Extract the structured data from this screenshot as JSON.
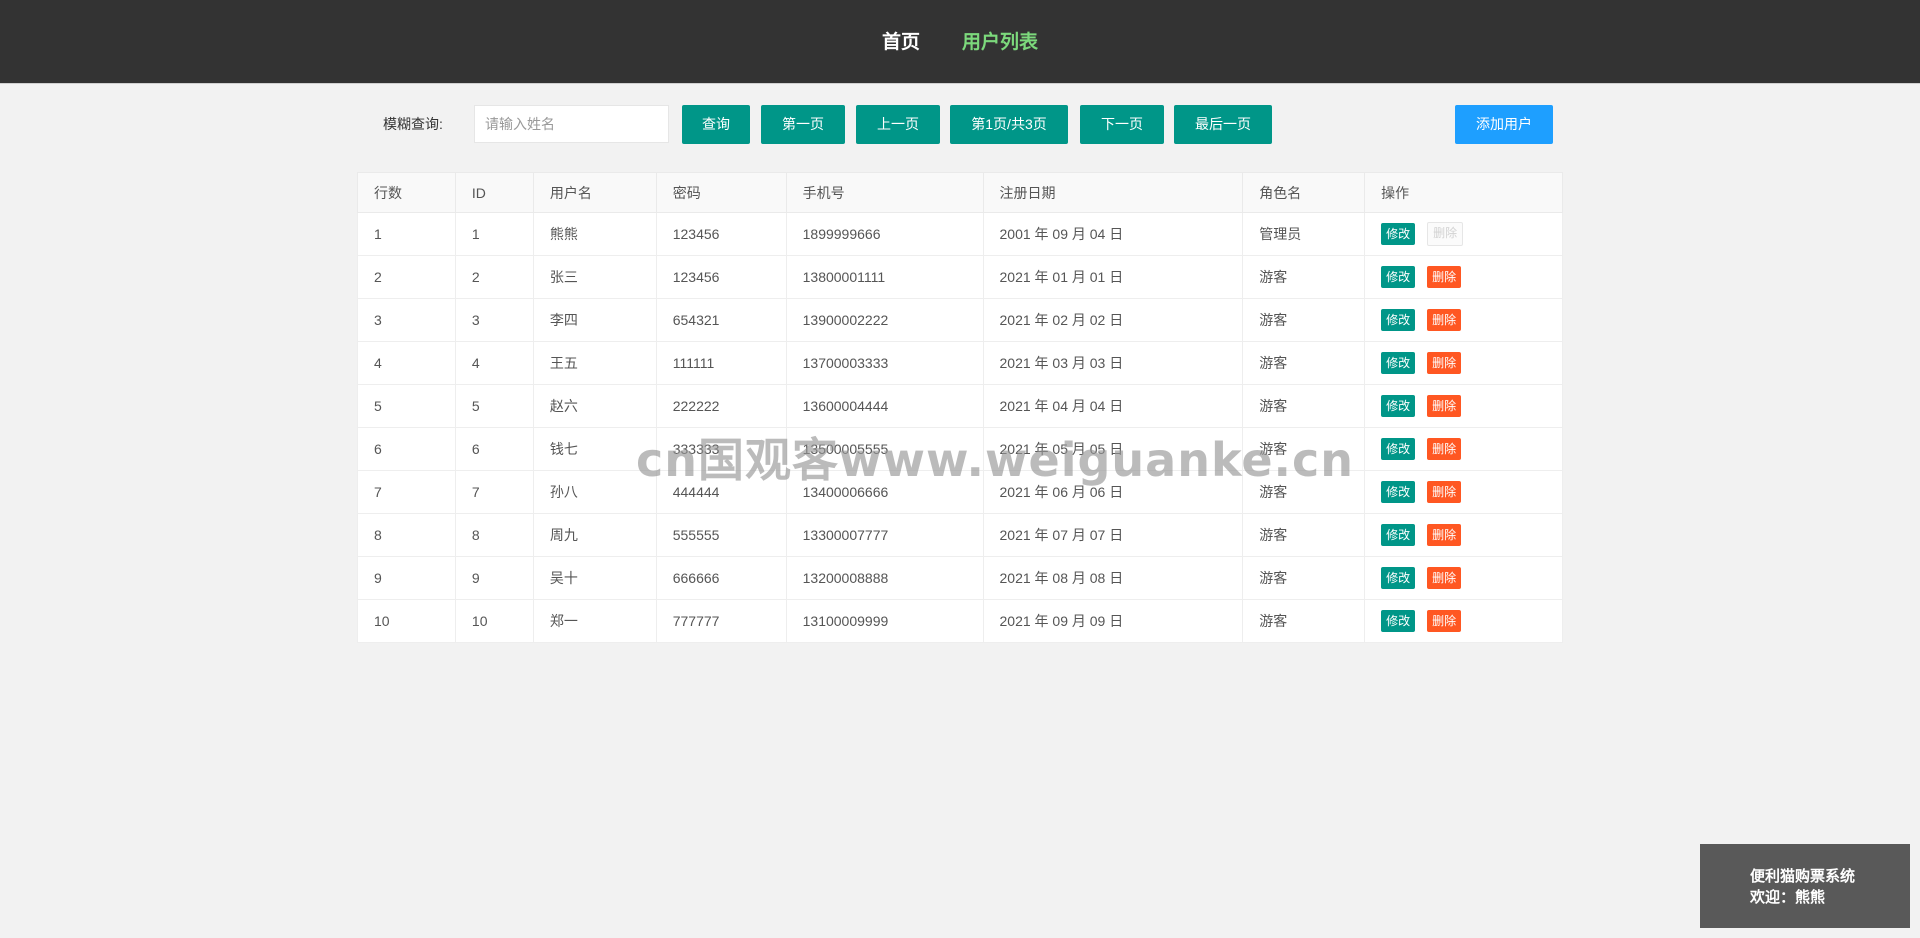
{
  "nav": {
    "home": "首页",
    "users": "用户列表"
  },
  "toolbar": {
    "search_label": "模糊查询:",
    "search_placeholder": "请输入姓名",
    "query": "查询",
    "first_page": "第一页",
    "prev_page": "上一页",
    "page_info": "第1页/共3页",
    "next_page": "下一页",
    "last_page": "最后一页",
    "add_user": "添加用户"
  },
  "table": {
    "headers": [
      "行数",
      "ID",
      "用户名",
      "密码",
      "手机号",
      "注册日期",
      "角色名",
      "操作"
    ],
    "edit_label": "修改",
    "delete_label": "删除",
    "rows": [
      {
        "row": "1",
        "id": "1",
        "username": "熊熊",
        "password": "123456",
        "phone": "1899999666",
        "date": "2001 年 09 月 04 日",
        "role": "管理员",
        "delete_disabled": true
      },
      {
        "row": "2",
        "id": "2",
        "username": "张三",
        "password": "123456",
        "phone": "13800001111",
        "date": "2021 年 01 月 01 日",
        "role": "游客",
        "delete_disabled": false
      },
      {
        "row": "3",
        "id": "3",
        "username": "李四",
        "password": "654321",
        "phone": "13900002222",
        "date": "2021 年 02 月 02 日",
        "role": "游客",
        "delete_disabled": false
      },
      {
        "row": "4",
        "id": "4",
        "username": "王五",
        "password": "111111",
        "phone": "13700003333",
        "date": "2021 年 03 月 03 日",
        "role": "游客",
        "delete_disabled": false
      },
      {
        "row": "5",
        "id": "5",
        "username": "赵六",
        "password": "222222",
        "phone": "13600004444",
        "date": "2021 年 04 月 04 日",
        "role": "游客",
        "delete_disabled": false
      },
      {
        "row": "6",
        "id": "6",
        "username": "钱七",
        "password": "333333",
        "phone": "13500005555",
        "date": "2021 年 05 月 05 日",
        "role": "游客",
        "delete_disabled": false
      },
      {
        "row": "7",
        "id": "7",
        "username": "孙八",
        "password": "444444",
        "phone": "13400006666",
        "date": "2021 年 06 月 06 日",
        "role": "游客",
        "delete_disabled": false
      },
      {
        "row": "8",
        "id": "8",
        "username": "周九",
        "password": "555555",
        "phone": "13300007777",
        "date": "2021 年 07 月 07 日",
        "role": "游客",
        "delete_disabled": false
      },
      {
        "row": "9",
        "id": "9",
        "username": "吴十",
        "password": "666666",
        "phone": "13200008888",
        "date": "2021 年 08 月 08 日",
        "role": "游客",
        "delete_disabled": false
      },
      {
        "row": "10",
        "id": "10",
        "username": "郑一",
        "password": "777777",
        "phone": "13100009999",
        "date": "2021 年 09 月 09 日",
        "role": "游客",
        "delete_disabled": false
      }
    ]
  },
  "watermark": "cn国观客www.weiguanke.cn",
  "footer": {
    "system_name": "便利猫购票系统",
    "welcome": "欢迎：熊熊"
  },
  "colors": {
    "topbar": "#333333",
    "active_nav": "#7cd97c",
    "primary": "#009688",
    "add_button": "#1e9fff",
    "danger": "#ff5722"
  }
}
